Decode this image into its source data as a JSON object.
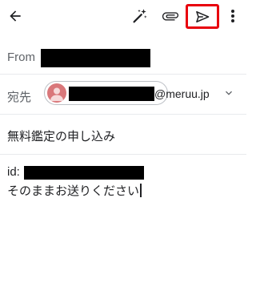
{
  "header": {
    "icons": [
      "back-arrow-icon",
      "magic-wand-icon",
      "attachment-icon",
      "send-icon",
      "more-vert-icon"
    ]
  },
  "from": {
    "label": "From"
  },
  "to": {
    "label": "宛先",
    "recipient_visible_text": "@meruu.jp"
  },
  "subject": {
    "value": "無料鑑定の申し込み"
  },
  "body": {
    "line1_prefix": "id:",
    "line2": "そのままお送りください"
  },
  "colors": {
    "highlight": "#e8000d",
    "label": "#5f6368",
    "text": "#202124",
    "avatar": "#d9777a"
  }
}
